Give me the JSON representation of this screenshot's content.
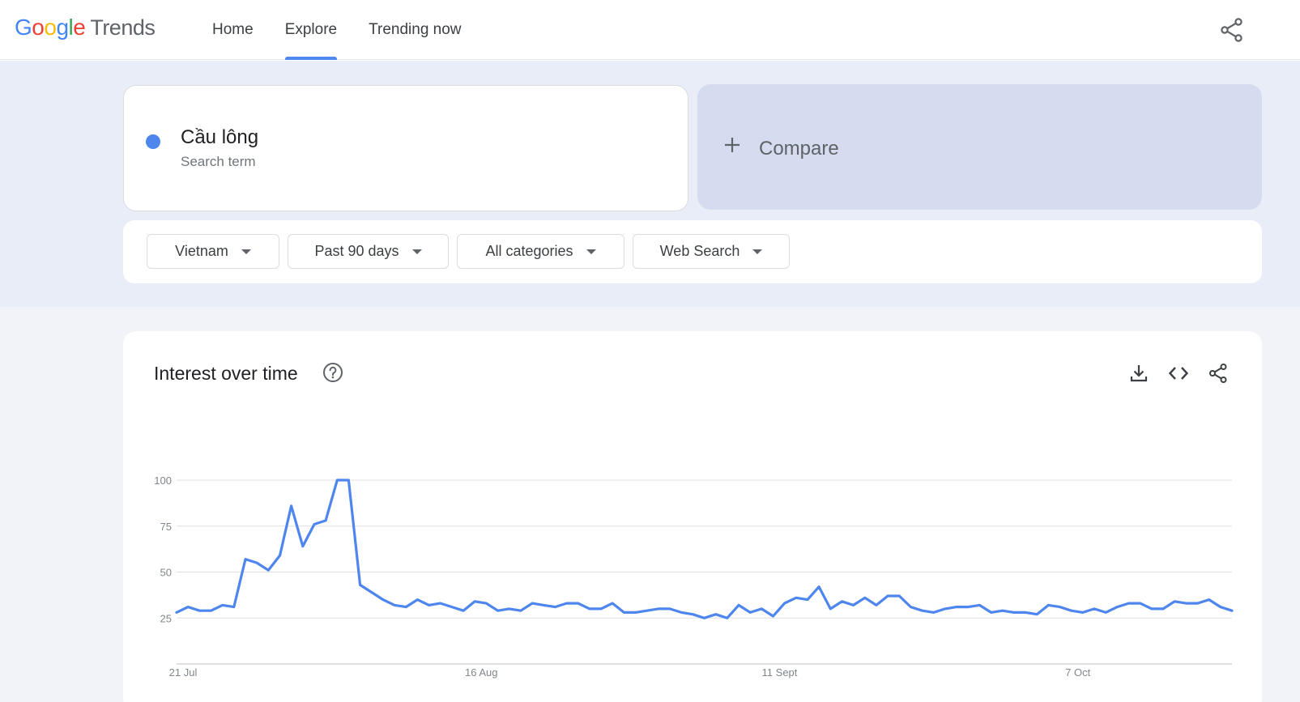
{
  "header": {
    "logo": {
      "google_letters": [
        "G",
        "o",
        "o",
        "g",
        "l",
        "e"
      ],
      "product": "Trends"
    },
    "nav": [
      {
        "label": "Home",
        "active": false
      },
      {
        "label": "Explore",
        "active": true
      },
      {
        "label": "Trending now",
        "active": false
      }
    ],
    "share_icon": "share-icon"
  },
  "term": {
    "name": "Cầu lông",
    "type": "Search term",
    "color": "#4e86ee"
  },
  "compare": {
    "label": "Compare",
    "icon": "plus-icon"
  },
  "filters": [
    {
      "label": "Vietnam"
    },
    {
      "label": "Past 90 days"
    },
    {
      "label": "All categories"
    },
    {
      "label": "Web Search"
    }
  ],
  "chart": {
    "title": "Interest over time",
    "tools": [
      "download-icon",
      "embed-code-icon",
      "share-icon"
    ]
  },
  "chart_data": {
    "type": "line",
    "title": "Interest over time",
    "series": [
      {
        "color": "#4e86ee",
        "values": [
          28,
          31,
          29,
          29,
          32,
          31,
          57,
          55,
          51,
          59,
          86,
          64,
          76,
          78,
          100,
          100,
          43,
          39,
          35,
          32,
          31,
          35,
          32,
          33,
          31,
          29,
          34,
          33,
          29,
          30,
          29,
          33,
          32,
          31,
          33,
          33,
          30,
          30,
          33,
          28,
          28,
          29,
          30,
          30,
          28,
          27,
          25,
          27,
          25,
          32,
          28,
          30,
          26,
          33,
          36,
          35,
          42,
          30,
          34,
          32,
          36,
          32,
          37,
          37,
          31,
          29,
          28,
          30,
          31,
          31,
          32,
          28,
          29,
          28,
          28,
          27,
          32,
          31,
          29,
          28,
          30,
          28,
          31,
          33,
          33,
          30,
          30,
          34,
          33,
          33,
          35,
          31,
          29
        ]
      }
    ],
    "x_labels": [
      "21 Jul",
      "16 Aug",
      "11 Sept",
      "7 Oct"
    ],
    "x_label_indices": [
      0,
      26,
      52,
      78
    ],
    "y_ticks": [
      25,
      50,
      75,
      100
    ],
    "ylim": [
      0,
      100
    ],
    "grid": true
  }
}
